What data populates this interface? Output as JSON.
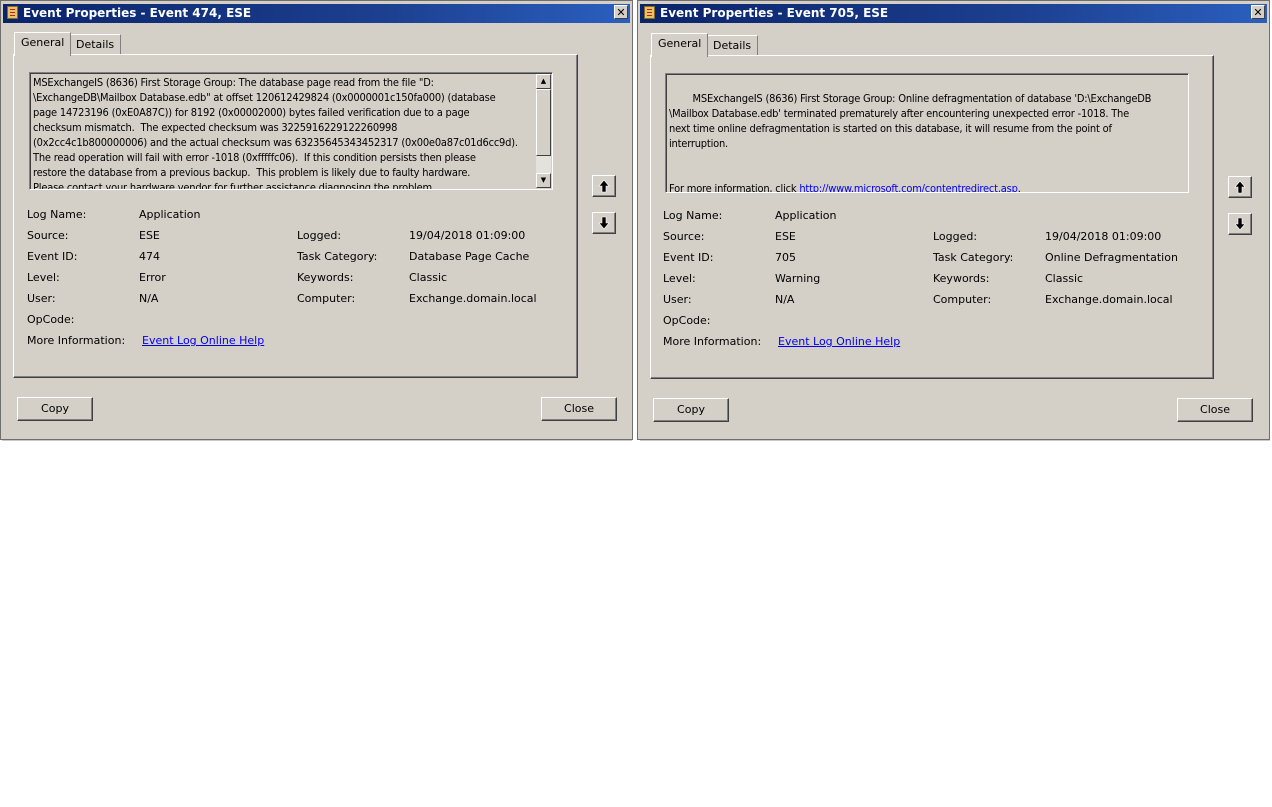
{
  "left_dialog": {
    "title": "Event Properties - Event 474, ESE",
    "tabs": [
      "General",
      "Details"
    ],
    "message": "MSExchangeIS (8636) First Storage Group: The database page read from the file \"D:\n\\ExchangeDB\\Mailbox Database.edb\" at offset 120612429824 (0x0000001c150fa000) (database\npage 14723196 (0xE0A87C)) for 8192 (0x00002000) bytes failed verification due to a page\nchecksum mismatch.  The expected checksum was 3225916229122260998\n(0x2cc4c1b800000006) and the actual checksum was 6323564534345231​7 (0x00e0a87c01d6cc9d).\nThe read operation will fail with error -1018 (0xfffffc06).  If this condition persists then please\nrestore the database from a previous backup.  This problem is likely due to faulty hardware.\nPlease contact your hardware vendor for further assistance diagnosing the problem.",
    "fields": {
      "log_name_label": "Log Name:",
      "log_name": "Application",
      "source_label": "Source:",
      "source": "ESE",
      "logged_label": "Logged:",
      "logged": "19/04/2018 01:09:00",
      "event_id_label": "Event ID:",
      "event_id": "474",
      "task_category_label": "Task Category:",
      "task_category": "Database Page Cache",
      "level_label": "Level:",
      "level": "Error",
      "keywords_label": "Keywords:",
      "keywords": "Classic",
      "user_label": "User:",
      "user": "N/A",
      "computer_label": "Computer:",
      "computer": "Exchange.domain.local",
      "opcode_label": "OpCode:",
      "more_info_label": "More Information:",
      "more_info_link": "Event Log Online Help"
    },
    "copy_label": "Copy",
    "close_label": "Close"
  },
  "right_dialog": {
    "title": "Event Properties - Event 705, ESE",
    "tabs": [
      "General",
      "Details"
    ],
    "message": "MSExchangeIS (8636) First Storage Group: Online defragmentation of database 'D:\\ExchangeDB\n\\Mailbox Database.edb' terminated prematurely after encountering unexpected error -1018. The\nnext time online defragmentation is started on this database, it will resume from the point of\ninterruption.",
    "message_more_prefix": "For more information, click ",
    "message_link": "http://www.microsoft.com/contentredirect.asp",
    "message_more_suffix": ".",
    "fields": {
      "log_name_label": "Log Name:",
      "log_name": "Application",
      "source_label": "Source:",
      "source": "ESE",
      "logged_label": "Logged:",
      "logged": "19/04/2018 01:09:00",
      "event_id_label": "Event ID:",
      "event_id": "705",
      "task_category_label": "Task Category:",
      "task_category": "Online Defragmentation",
      "level_label": "Level:",
      "level": "Warning",
      "keywords_label": "Keywords:",
      "keywords": "Classic",
      "user_label": "User:",
      "user": "N/A",
      "computer_label": "Computer:",
      "computer": "Exchange.domain.local",
      "opcode_label": "OpCode:",
      "more_info_label": "More Information:",
      "more_info_link": "Event Log Online Help"
    },
    "copy_label": "Copy",
    "close_label": "Close"
  },
  "colors": {
    "dialog_bg": "#d4d0c8",
    "titlebar": "#0a246a",
    "link": "#0000ee"
  }
}
